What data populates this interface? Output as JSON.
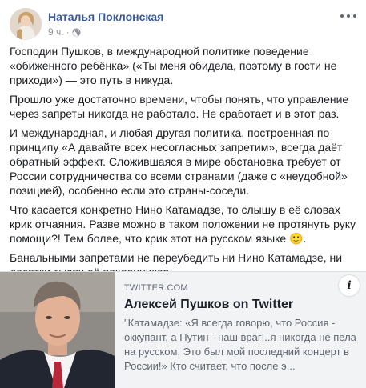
{
  "post": {
    "author": "Наталья Поклонская",
    "time": "9 ч.",
    "time_separator": "·",
    "privacy_icon": "globe-icon",
    "more_icon": "ellipsis-icon",
    "paragraphs": [
      "Господин Пушков, в международной политике поведение «обиженного ребёнка» («Ты меня обидела, поэтому в гости не приходи») — это путь в никуда.",
      "Прошло уже достаточно времени, чтобы понять, что управление через запреты никогда не работало. Не сработает и в этот раз.",
      "И международная, и любая другая политика, построенная по принципу «А давайте всех несогласных запретим», всегда даёт обратный эффект. Сложившаяся в мире обстановка требует от России сотрудничества со всеми странами (даже с «неудобной» позицией), особенно если это страны-соседи.",
      "Что касается конкретно Нино Катамадзе, то слышу в её словах крик отчаяния. Разве можно в таком положении не протянуть руку помощи?! Тем более, что крик этот на русском языке 🙂.",
      "Банальными запретами не переубедить ни Нино Катамадзе, ни десятки тысяч её поклонников."
    ]
  },
  "link_card": {
    "source": "TWITTER.COM",
    "title": "Алексей Пушков on Twitter",
    "description": "\"Катамадзе: «Я всегда говорю, что Россия - оккупант, а Путин - наш враг!..я никогда не пела на русском. Это был мой последний концерт в России!» Кто считает, что после э...",
    "info_label": "i"
  },
  "colors": {
    "author": "#385898",
    "meta": "#90949c",
    "card_bg": "#f2f3f5"
  }
}
